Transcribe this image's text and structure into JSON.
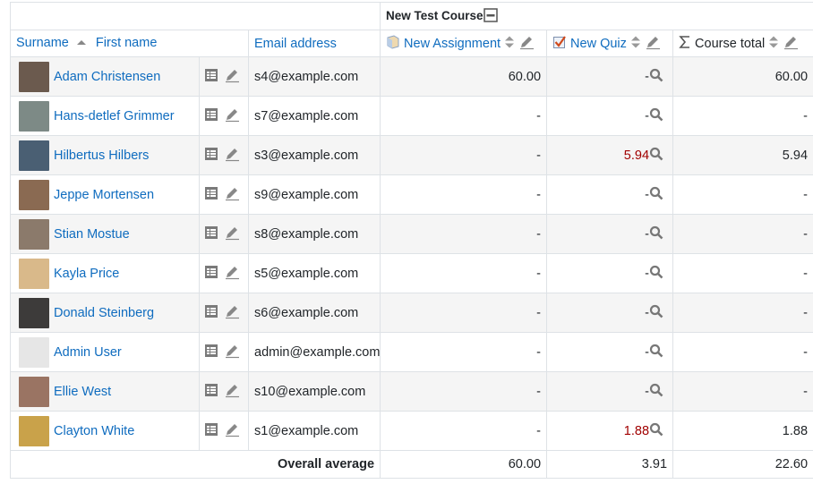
{
  "course_title": "New Test Course",
  "headers": {
    "surname": "Surname",
    "firstname": "First name",
    "email": "Email address",
    "assignment": "New Assignment",
    "quiz": "New Quiz",
    "total": "Course total"
  },
  "students": [
    {
      "name": "Adam Christensen",
      "email": "s4@example.com",
      "assignment": "60.00",
      "quiz": "-",
      "total": "60.00",
      "avatar_color": "#6b5a4e",
      "quiz_overridden": false
    },
    {
      "name": "Hans-detlef Grimmer",
      "email": "s7@example.com",
      "assignment": "-",
      "quiz": "-",
      "total": "-",
      "avatar_color": "#7d8a86",
      "quiz_overridden": false
    },
    {
      "name": "Hilbertus Hilbers",
      "email": "s3@example.com",
      "assignment": "-",
      "quiz": "5.94",
      "total": "5.94",
      "avatar_color": "#4a5f73",
      "quiz_overridden": true
    },
    {
      "name": "Jeppe Mortensen",
      "email": "s9@example.com",
      "assignment": "-",
      "quiz": "-",
      "total": "-",
      "avatar_color": "#8a6a52",
      "quiz_overridden": false
    },
    {
      "name": "Stian Mostue",
      "email": "s8@example.com",
      "assignment": "-",
      "quiz": "-",
      "total": "-",
      "avatar_color": "#8b7a6b",
      "quiz_overridden": false
    },
    {
      "name": "Kayla Price",
      "email": "s5@example.com",
      "assignment": "-",
      "quiz": "-",
      "total": "-",
      "avatar_color": "#d9b98a",
      "quiz_overridden": false
    },
    {
      "name": "Donald Steinberg",
      "email": "s6@example.com",
      "assignment": "-",
      "quiz": "-",
      "total": "-",
      "avatar_color": "#3d3b3a",
      "quiz_overridden": false
    },
    {
      "name": "Admin User",
      "email": "admin@example.com",
      "assignment": "-",
      "quiz": "-",
      "total": "-",
      "avatar_color": "#e6e6e6",
      "quiz_overridden": false
    },
    {
      "name": "Ellie West",
      "email": "s10@example.com",
      "assignment": "-",
      "quiz": "-",
      "total": "-",
      "avatar_color": "#9a7463",
      "quiz_overridden": false
    },
    {
      "name": "Clayton White",
      "email": "s1@example.com",
      "assignment": "-",
      "quiz": "1.88",
      "total": "1.88",
      "avatar_color": "#c9a24a",
      "quiz_overridden": true
    }
  ],
  "overall": {
    "label": "Overall average",
    "assignment": "60.00",
    "quiz": "3.91",
    "total": "22.60"
  }
}
